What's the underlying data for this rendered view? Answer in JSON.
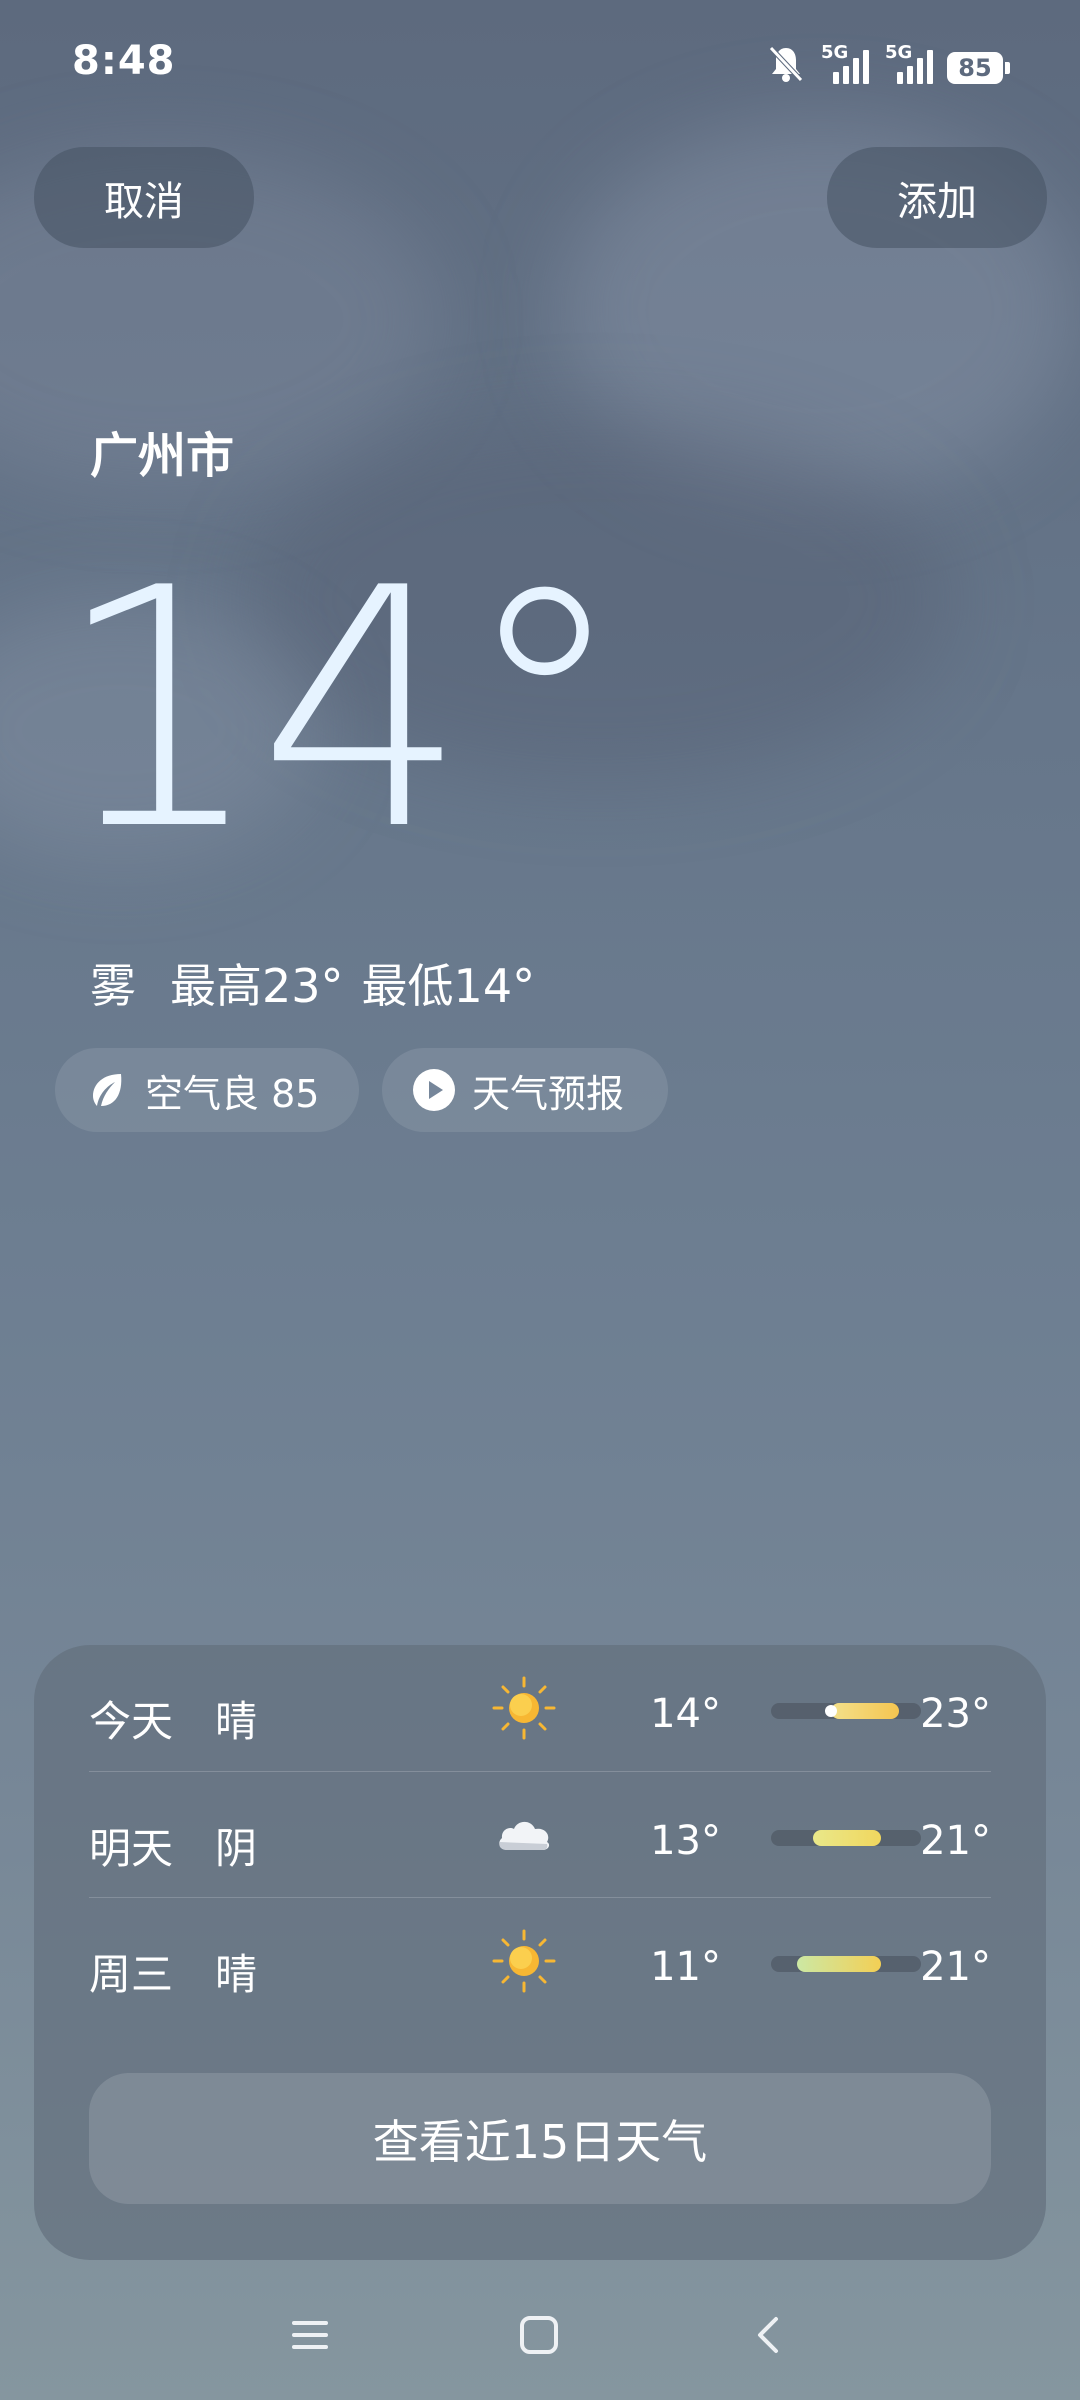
{
  "status_bar": {
    "time": "8:48",
    "network_1": "5G",
    "network_2": "5G",
    "battery": "85",
    "icons": [
      "bell-muted-icon",
      "signal-icon",
      "signal-icon",
      "battery-icon"
    ]
  },
  "header": {
    "cancel_label": "取消",
    "add_label": "添加"
  },
  "current": {
    "city": "广州市",
    "temperature": "14°",
    "condition": "雾",
    "high": "最高23°",
    "low": "最低14°"
  },
  "chips": {
    "air_quality": "空气良 85",
    "forecast_video": "天气预报"
  },
  "forecast": [
    {
      "day": "今天",
      "condition": "晴",
      "icon": "sun-icon",
      "low": "14°",
      "high": "23°",
      "range_start": 0.4,
      "range_end": 0.85,
      "now": 0.4,
      "colors": [
        "#f3e08b",
        "#f5c550"
      ]
    },
    {
      "day": "明天",
      "condition": "阴",
      "icon": "cloud-icon",
      "low": "13°",
      "high": "21°",
      "range_start": 0.28,
      "range_end": 0.73,
      "colors": [
        "#e9e88a",
        "#f1d75e"
      ]
    },
    {
      "day": "周三",
      "condition": "晴",
      "icon": "sun-icon",
      "low": "11°",
      "high": "21°",
      "range_start": 0.17,
      "range_end": 0.73,
      "colors": [
        "#cce8a4",
        "#f3cf55"
      ]
    }
  ],
  "more_label": "查看近15日天气",
  "colors": {
    "sun": "#f7b733",
    "background_top": "#5d6a7e",
    "background_bottom": "#85969f"
  },
  "nav": {
    "icons": [
      "menu-icon",
      "home-icon",
      "back-icon"
    ]
  }
}
